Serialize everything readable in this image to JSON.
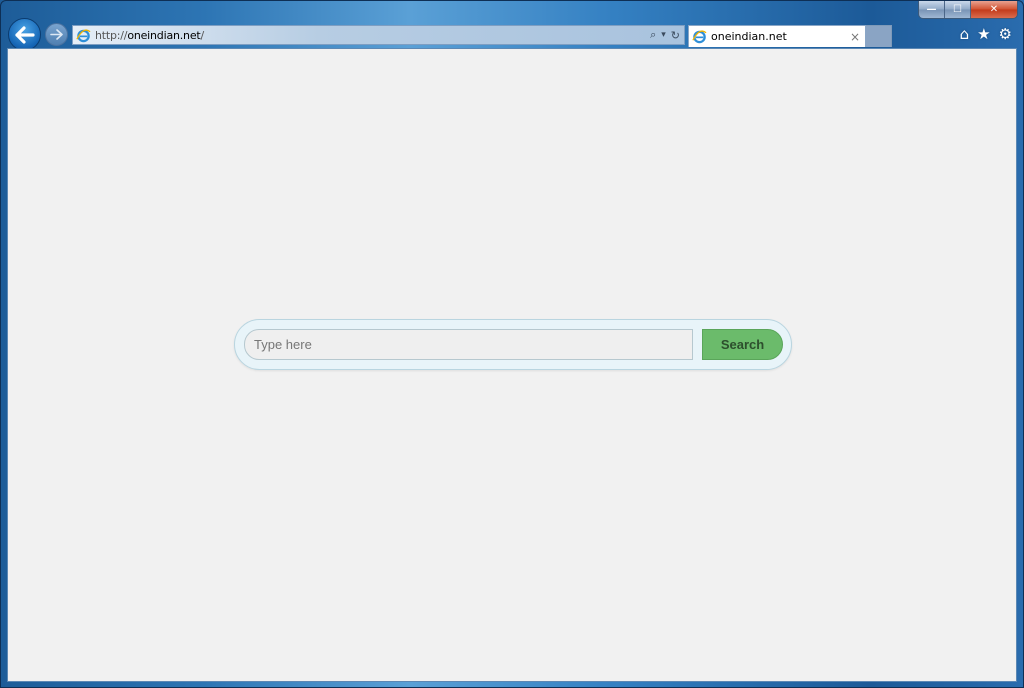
{
  "window": {
    "caption_buttons": {
      "minimize": "—",
      "maximize": "☐",
      "close": "✕"
    }
  },
  "navigation": {
    "back_icon": "arrow-left",
    "forward_icon": "arrow-right"
  },
  "address_bar": {
    "url_prefix": "http://",
    "url_domain": "oneindian.net",
    "url_suffix": "/",
    "search_glyph": "⌕",
    "dropdown_glyph": "▾",
    "refresh_glyph": "↻"
  },
  "tabs": [
    {
      "title": "oneindian.net",
      "close_glyph": "×",
      "active": true
    }
  ],
  "toolbar": {
    "home_glyph": "⌂",
    "favorites_glyph": "★",
    "tools_glyph": "⚙"
  },
  "page": {
    "search": {
      "placeholder": "Type here",
      "value": "",
      "button_label": "Search"
    },
    "colors": {
      "background": "#f1f1f1",
      "button": "#6bbb6b",
      "button_text": "#2d4f2d",
      "pill": "#e8f4f9"
    }
  }
}
